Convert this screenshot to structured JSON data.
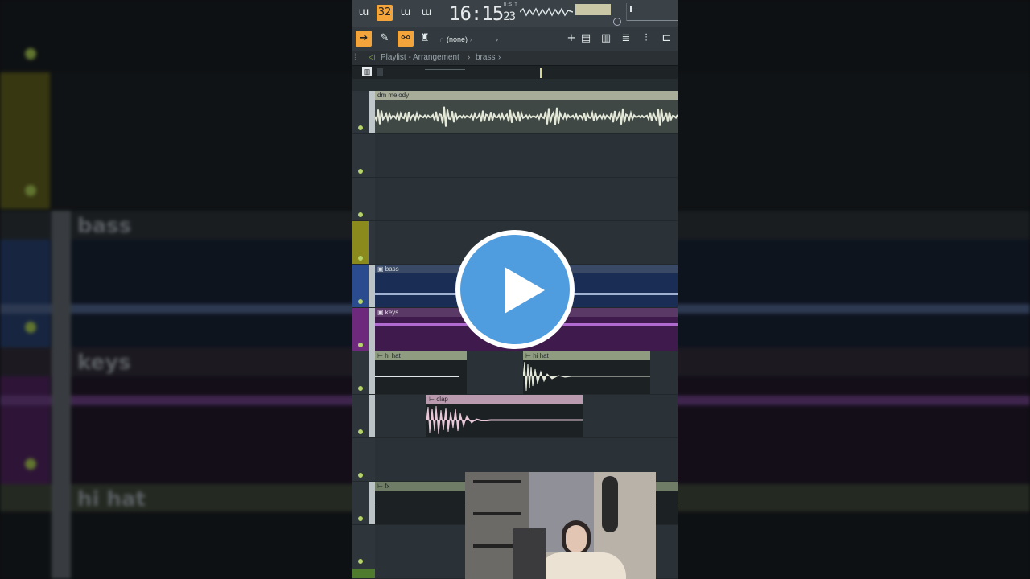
{
  "toolbar": {
    "clock_main": "16:15",
    "clock_sub": "23",
    "clock_mode": "B:S:T",
    "snap_value": "(none)",
    "pattern_name": "brass",
    "beat_icon": "32"
  },
  "breadcrumb": {
    "window": "Playlist - Arrangement",
    "sep": "›",
    "pattern": "brass",
    "pattern_arrow": "›"
  },
  "tracks": [
    {
      "clips": [
        {
          "label": "dm melody"
        }
      ]
    },
    {
      "clips": []
    },
    {
      "clips": []
    },
    {
      "clips": []
    },
    {
      "clips": [
        {
          "label": "bass"
        }
      ]
    },
    {
      "clips": [
        {
          "label": "keys"
        }
      ]
    },
    {
      "clips": [
        {
          "label": "hi hat"
        },
        {
          "label": "hi hat"
        }
      ]
    },
    {
      "clips": [
        {
          "label": "clap"
        }
      ]
    },
    {
      "clips": []
    },
    {
      "clips": [
        {
          "label": "fx"
        }
      ]
    }
  ],
  "background_labels": {
    "bass": "bass",
    "keys": "keys",
    "hihat": "hi hat"
  },
  "colors": {
    "yellow_track": "#8b8a1d",
    "bass_track": "#2a4c8e",
    "keys_track": "#6d2a7d",
    "accent_orange": "#f3a43a",
    "play_button": "#4f9ddf"
  }
}
